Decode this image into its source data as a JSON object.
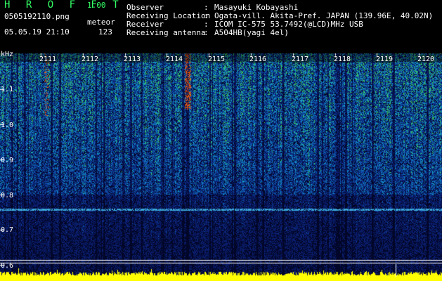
{
  "header": {
    "app_title": "H R O F F T",
    "app_version": "1.00",
    "file_name": "0505192110.png",
    "date_time": "05.05.19 21:10",
    "mode": "meteor",
    "count": "123"
  },
  "info": [
    {
      "label": "Observer",
      "value": "Masayuki Kobayashi"
    },
    {
      "label": "Receiving Location",
      "value": "Ogata-vill. Akita-Pref. JAPAN (139.96E, 40.02N)"
    },
    {
      "label": "Receiver",
      "value": "ICOM IC-575 53.7492(@LCD)MHz USB"
    },
    {
      "label": "Receiving antenna",
      "value": "A504HB(yagi 4el)"
    }
  ],
  "spectrogram": {
    "unit": "kHz",
    "freq_ticks": [
      "1.1",
      "1.0",
      "0.9",
      "0.8",
      "0.7",
      "0.6"
    ],
    "time_ticks": [
      "2111",
      "2112",
      "2113",
      "2114",
      "2115",
      "2116",
      "2117",
      "2118",
      "2119",
      "2120"
    ]
  },
  "colors": {
    "background": "#000000",
    "title": "#33ff66",
    "text": "#ffffff",
    "noise_low": "#0a1e6e",
    "noise_high": "#1e8cc8",
    "hot": "#ff3c00",
    "baseline": "#ffff00"
  }
}
